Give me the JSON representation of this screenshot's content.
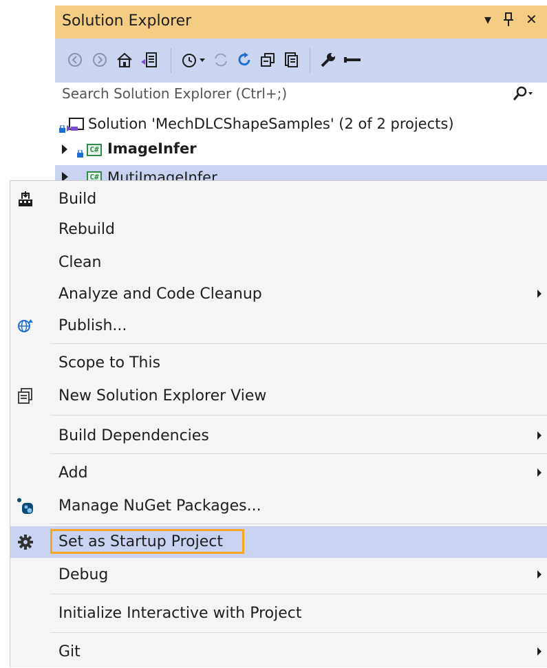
{
  "solution_explorer": {
    "title": "Solution Explorer",
    "controls": {
      "dropdown": "▾",
      "pin": "📌",
      "close": "✕"
    },
    "search_placeholder": "Search Solution Explorer (Ctrl+;)",
    "tree": [
      {
        "label": "Solution 'MechDLCShapeSamples' (2 of 2 projects)",
        "type": "solution"
      },
      {
        "label": "ImageInfer",
        "type": "project",
        "bold": true
      },
      {
        "label": "MutiImageInfer",
        "type": "project",
        "bold": false,
        "selected": true
      }
    ],
    "project_badge": "C#"
  },
  "context_menu": {
    "items": [
      {
        "label": "Build",
        "icon": "build-icon",
        "submenu": false
      },
      {
        "label": "Rebuild",
        "icon": "",
        "submenu": false
      },
      {
        "label": "Clean",
        "icon": "",
        "submenu": false
      },
      {
        "label": "Analyze and Code Cleanup",
        "icon": "",
        "submenu": true
      },
      {
        "label": "Publish...",
        "icon": "publish-globe-icon",
        "submenu": false
      },
      {
        "label": "Scope to This",
        "icon": "",
        "submenu": false
      },
      {
        "label": "New Solution Explorer View",
        "icon": "new-view-icon",
        "submenu": false
      },
      {
        "label": "Build Dependencies",
        "icon": "",
        "submenu": true
      },
      {
        "label": "Add",
        "icon": "",
        "submenu": true
      },
      {
        "label": "Manage NuGet Packages...",
        "icon": "nuget-icon",
        "submenu": false
      },
      {
        "label": "Set as Startup Project",
        "icon": "gear-icon",
        "submenu": false,
        "selected": true
      },
      {
        "label": "Debug",
        "icon": "",
        "submenu": true
      },
      {
        "label": "Initialize Interactive with Project",
        "icon": "",
        "submenu": false
      },
      {
        "label": "Git",
        "icon": "",
        "submenu": true
      }
    ]
  },
  "colors": {
    "title_bar": "#f5cc84",
    "toolbar": "#ccd5f0",
    "menu_bg": "#f5f5f5",
    "selection": "#c9d3f0",
    "highlight_border": "#f5a623"
  }
}
